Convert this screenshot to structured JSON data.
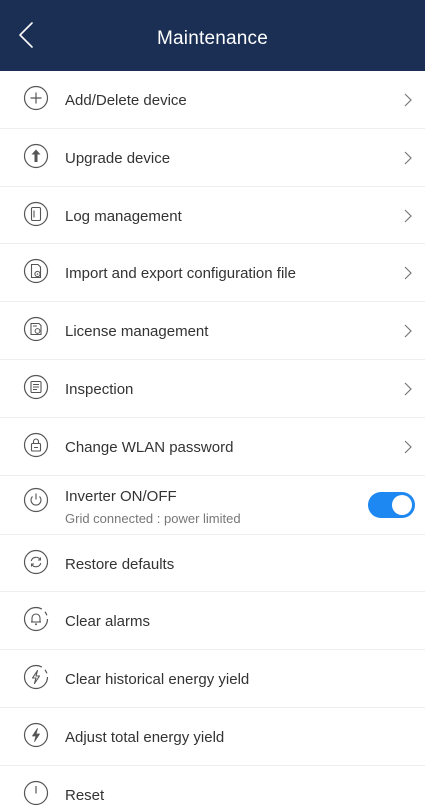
{
  "header": {
    "title": "Maintenance",
    "background": "#1b2f55"
  },
  "items": [
    {
      "label": "Add/Delete device",
      "icon": "plus-circle-icon",
      "chevron": true
    },
    {
      "label": "Upgrade device",
      "icon": "upgrade-icon",
      "chevron": true
    },
    {
      "label": "Log management",
      "icon": "log-icon",
      "chevron": true
    },
    {
      "label": "Import and export configuration file",
      "icon": "config-file-icon",
      "chevron": true
    },
    {
      "label": "License management",
      "icon": "license-icon",
      "chevron": true
    },
    {
      "label": "Inspection",
      "icon": "inspection-icon",
      "chevron": true
    },
    {
      "label": "Change WLAN password",
      "icon": "wlan-password-icon",
      "chevron": true
    },
    {
      "label": "Inverter ON/OFF",
      "sublabel": "Grid connected : power limited",
      "icon": "power-icon",
      "toggle": true,
      "toggle_on": true,
      "toggle_color": "#1e88f2"
    },
    {
      "label": "Restore defaults",
      "icon": "restore-icon"
    },
    {
      "label": "Clear alarms",
      "icon": "clear-alarms-icon"
    },
    {
      "label": "Clear historical energy yield",
      "icon": "clear-energy-icon"
    },
    {
      "label": "Adjust total energy yield",
      "icon": "adjust-energy-icon"
    },
    {
      "label": "Reset",
      "icon": "reset-icon"
    }
  ]
}
